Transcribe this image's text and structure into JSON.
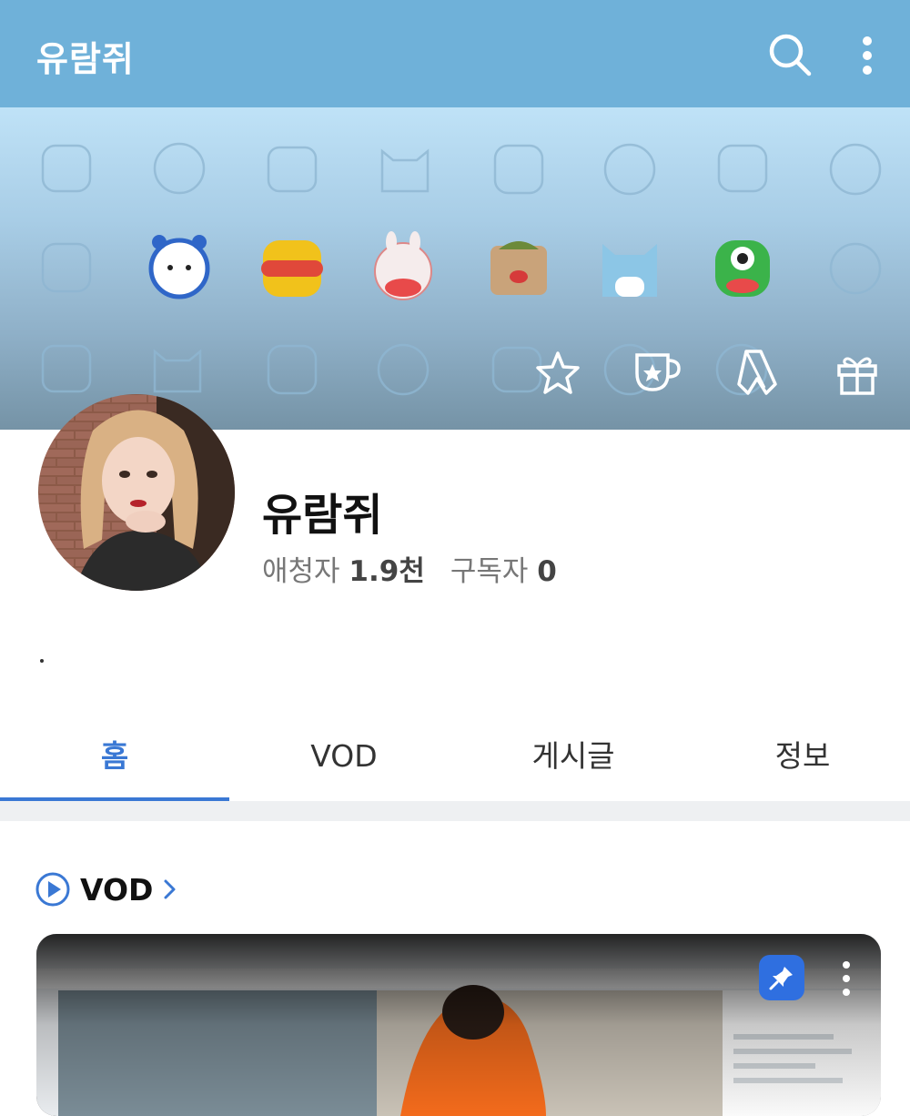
{
  "header": {
    "title": "유람쥐",
    "search_icon": "search-icon",
    "more_icon": "more-vertical-icon"
  },
  "banner": {
    "actions": [
      {
        "name": "favorite",
        "icon": "star-outline-icon"
      },
      {
        "name": "sticker",
        "icon": "cup-star-icon"
      },
      {
        "name": "ribbon",
        "icon": "ribbon-icon"
      },
      {
        "name": "gift",
        "icon": "gift-icon"
      }
    ]
  },
  "profile": {
    "name": "유람쥐",
    "fans_label": "애청자",
    "fans_value": "1.9천",
    "subscribers_label": "구독자",
    "subscribers_value": "0",
    "bio": "."
  },
  "tabs": [
    {
      "label": "홈",
      "active": true
    },
    {
      "label": "VOD",
      "active": false
    },
    {
      "label": "게시글",
      "active": false
    },
    {
      "label": "정보",
      "active": false
    }
  ],
  "section": {
    "title": "VOD",
    "icon": "play-circle-icon"
  },
  "colors": {
    "appbar": "#6fb1d9",
    "accent": "#3a78d4",
    "pin": "#2f6fe0"
  }
}
